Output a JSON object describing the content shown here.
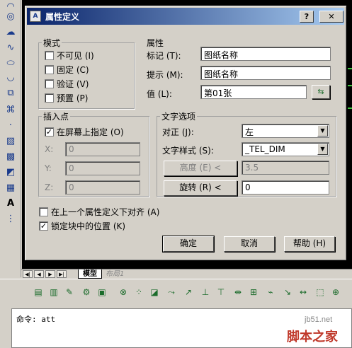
{
  "dialog": {
    "title": "属性定义",
    "help_glyph": "?",
    "close_glyph": "✕",
    "mode": {
      "label": "模式",
      "options": [
        {
          "label": "不可见 (I)",
          "checked": false
        },
        {
          "label": "固定 (C)",
          "checked": false
        },
        {
          "label": "验证 (V)",
          "checked": false
        },
        {
          "label": "预置 (P)",
          "checked": false
        }
      ]
    },
    "attribute": {
      "label": "属性",
      "tag_label": "标记 (T):",
      "tag_value": "图纸名称",
      "prompt_label": "提示 (M):",
      "prompt_value": "图纸名称",
      "value_label": "值 (L):",
      "value_value": "第01张"
    },
    "insertion": {
      "label": "插入点",
      "specify_on_screen": "在屏幕上指定 (O)",
      "specify_checked": true,
      "x_label": "X:",
      "x_value": "0",
      "y_label": "Y:",
      "y_value": "0",
      "z_label": "Z:",
      "z_value": "0"
    },
    "text_options": {
      "label": "文字选项",
      "justify_label": "对正 (J):",
      "justify_value": "左",
      "style_label": "文字样式 (S):",
      "style_value": "_TEL_DIM",
      "height_button": "高度 (E) <",
      "height_value": "3.5",
      "rotation_button": "旋转 (R) <",
      "rotation_value": "0"
    },
    "align_below": {
      "label": "在上一个属性定义下对齐 (A)",
      "checked": false
    },
    "lock_position": {
      "label": "锁定块中的位置 (K)",
      "checked": true
    },
    "buttons": {
      "ok": "确定",
      "cancel": "取消",
      "help": "帮助 (H)"
    }
  },
  "layout_tabs": {
    "model": "模型",
    "layout1": "布局1"
  },
  "command_line": "命令: att",
  "watermark": {
    "url": "jb51.net",
    "logo": "脚本之家"
  }
}
